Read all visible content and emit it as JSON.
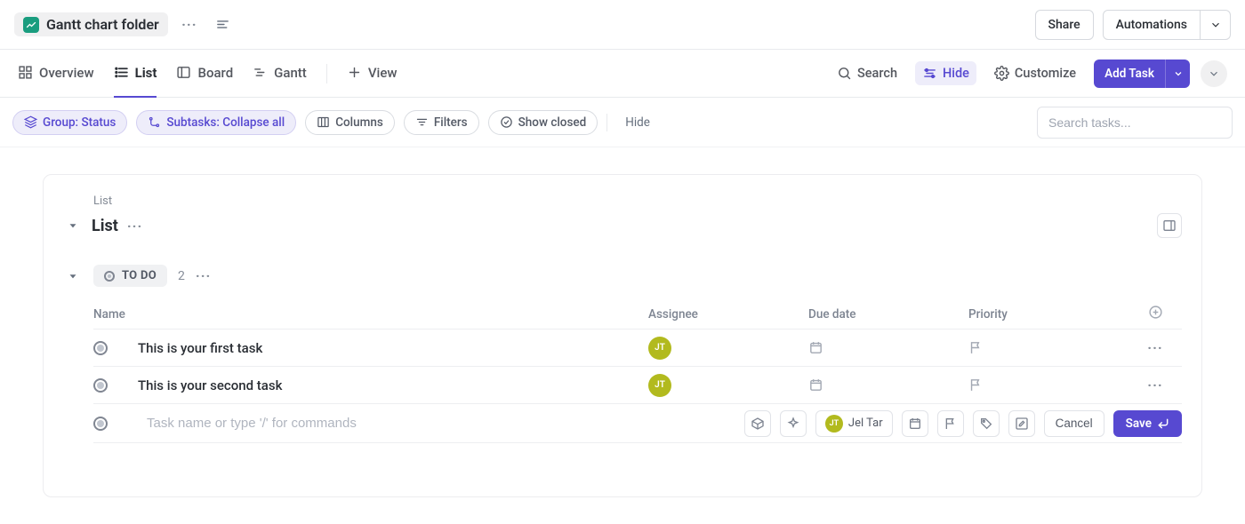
{
  "header": {
    "folder_title": "Gantt chart folder",
    "share_label": "Share",
    "automations_label": "Automations"
  },
  "tabs": {
    "items": [
      {
        "label": "Overview",
        "icon": "grid-icon"
      },
      {
        "label": "List",
        "icon": "list-icon",
        "active": true
      },
      {
        "label": "Board",
        "icon": "board-icon"
      },
      {
        "label": "Gantt",
        "icon": "gantt-icon"
      }
    ],
    "add_view_label": "View",
    "search_label": "Search",
    "hide_label": "Hide",
    "customize_label": "Customize",
    "add_task_label": "Add Task"
  },
  "filters": {
    "group_label": "Group: Status",
    "subtasks_label": "Subtasks: Collapse all",
    "columns_label": "Columns",
    "filters_label": "Filters",
    "show_closed_label": "Show closed",
    "hide_label": "Hide",
    "search_placeholder": "Search tasks..."
  },
  "list": {
    "crumb": "List",
    "title": "List",
    "status": {
      "label": "TO DO",
      "count": "2"
    },
    "columns": {
      "name": "Name",
      "assignee": "Assignee",
      "due": "Due date",
      "priority": "Priority"
    },
    "tasks": [
      {
        "name": "This is your first task",
        "assignee_initials": "JT"
      },
      {
        "name": "This is your second task",
        "assignee_initials": "JT"
      }
    ],
    "new_task": {
      "placeholder": "Task name or type '/' for commands",
      "assignee_label": "Jel Tar",
      "assignee_initials": "JT",
      "cancel_label": "Cancel",
      "save_label": "Save"
    }
  },
  "colors": {
    "primary": "#5749d1",
    "avatar": "#b2ba1e",
    "folder_icon": "#1a9d7f"
  }
}
